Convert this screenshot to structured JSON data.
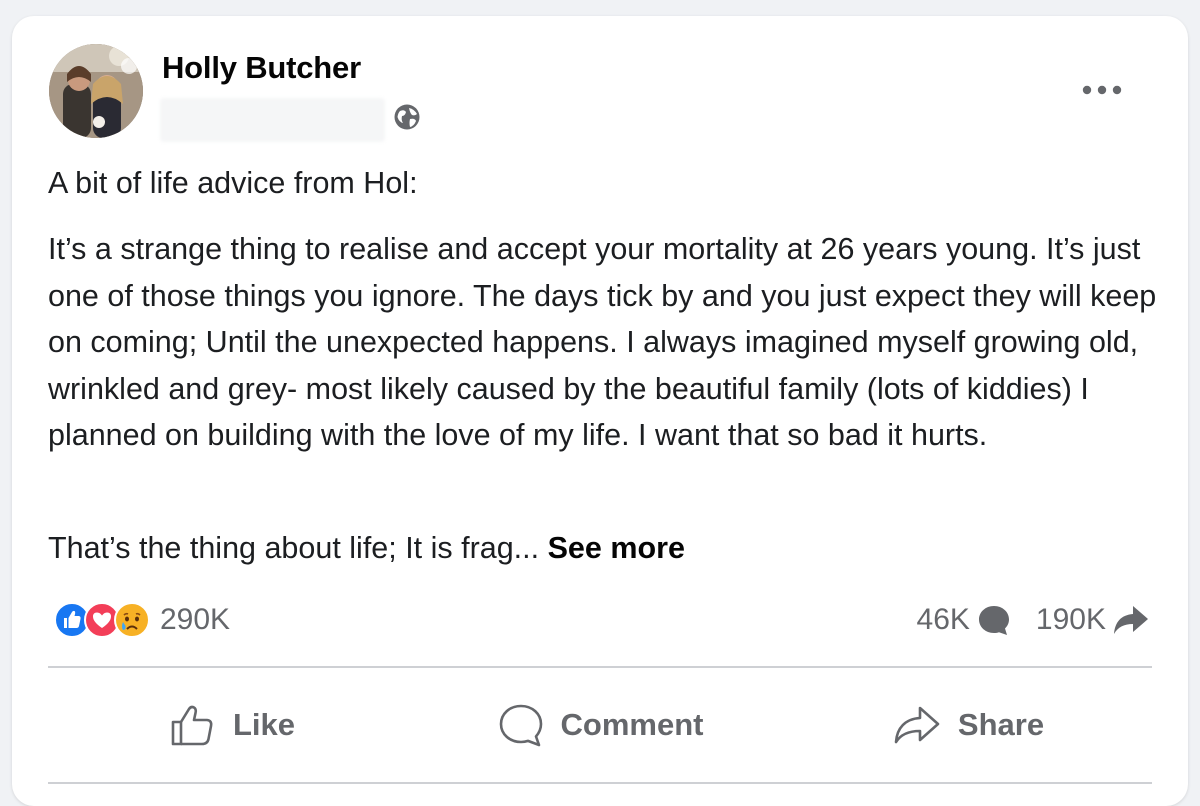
{
  "post": {
    "author": "Holly Butcher",
    "paragraphs": [
      "A bit of life advice from Hol:",
      "It’s a strange thing to realise and accept your mortality at 26 years young. It’s just one of those things you ignore. The days tick by and you just expect they will keep on coming; Until the unexpected happens. I always imagined myself growing old, wrinkled and grey- most likely caused by the beautiful family (lots of kiddies) I planned on building with the love of my life. I want that so bad it hurts.",
      "That’s the thing about life; It is frag..."
    ],
    "see_more_label": "See more"
  },
  "stats": {
    "reactions_count": "290K",
    "comments_count": "46K",
    "shares_count": "190K",
    "reaction_icons": [
      "like-icon",
      "love-icon",
      "sad-icon"
    ]
  },
  "actions": {
    "like_label": "Like",
    "comment_label": "Comment",
    "share_label": "Share"
  },
  "colors": {
    "like_blue": "#1877f2",
    "love_red": "#f33e58",
    "sad_yellow": "#f7b125",
    "secondary_text": "#65676b",
    "primary_text": "#050505",
    "page_background": "#f0f2f5"
  }
}
